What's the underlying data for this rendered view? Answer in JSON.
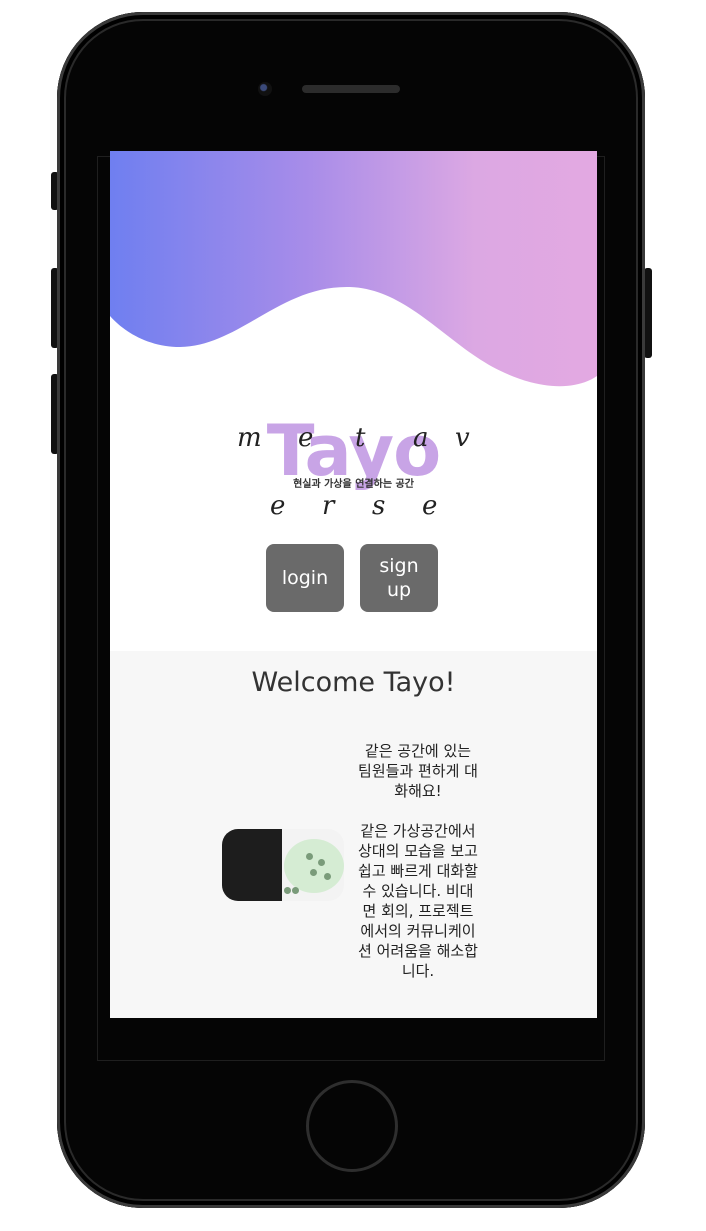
{
  "app": {
    "logo_text": "Tayo",
    "logo_script_left": [
      "m",
      "e",
      "t",
      "a",
      "v"
    ],
    "logo_script_bottom": [
      "e",
      "r",
      "s",
      "e"
    ],
    "logo_subtitle": "현실과 가상을 연결하는 공간"
  },
  "auth": {
    "login_label": "login",
    "signup_label": "sign up"
  },
  "welcome": {
    "title": "Welcome Tayo!",
    "feature1": "같은 공간에 있는 팀원들과 편하게 대화해요!",
    "feature2": "같은 가상공간에서 상대의 모습을 보고 쉽고 빠르게 대화할 수 있습니다. 비대면 회의, 프로젝트에서의 커뮤니케이션 어려움을 해소합니다."
  },
  "colors": {
    "gradient_start": "#6f7ff0",
    "gradient_end": "#e3a9e2",
    "button_bg": "#6a6a6a",
    "section_bg": "#f7f7f7"
  },
  "icons": {
    "camera": "camera-icon",
    "home": "home-button"
  }
}
